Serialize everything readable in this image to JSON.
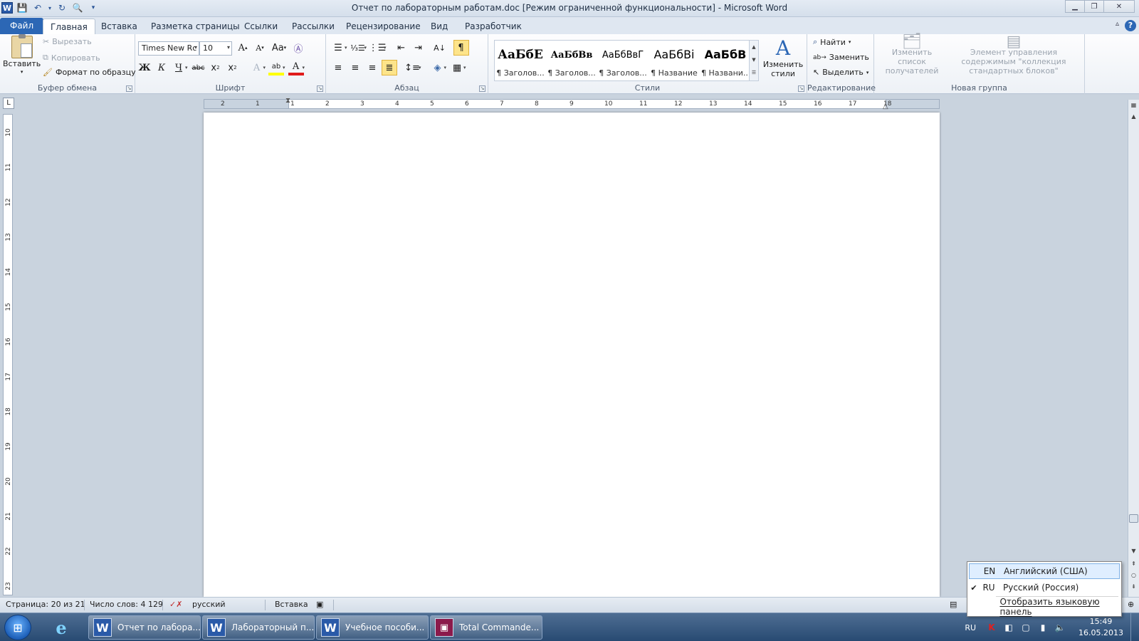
{
  "window": {
    "title": "Отчет по лабораторным работам.doc [Режим ограниченной функциональности]  -  Microsoft Word"
  },
  "tabs": [
    {
      "label": "Файл",
      "id": "file"
    },
    {
      "label": "Главная",
      "id": "home",
      "active": true
    },
    {
      "label": "Вставка",
      "id": "insert"
    },
    {
      "label": "Разметка страницы",
      "id": "layout"
    },
    {
      "label": "Ссылки",
      "id": "references"
    },
    {
      "label": "Рассылки",
      "id": "mailings"
    },
    {
      "label": "Рецензирование",
      "id": "review"
    },
    {
      "label": "Вид",
      "id": "view"
    },
    {
      "label": "Разработчик",
      "id": "developer"
    }
  ],
  "ribbon": {
    "clipboard": {
      "label": "Буфер обмена",
      "paste": "Вставить",
      "cut": "Вырезать",
      "copy": "Копировать",
      "format_painter": "Формат по образцу"
    },
    "font": {
      "label": "Шрифт",
      "font_name": "Times New Rc",
      "font_size": "10"
    },
    "paragraph": {
      "label": "Абзац"
    },
    "styles": {
      "label": "Стили",
      "change_styles": "Изменить стили",
      "items": [
        {
          "sample": "АаБбЕ",
          "name": "¶ Заголов..."
        },
        {
          "sample": "АаБбВв",
          "name": "¶ Заголов..."
        },
        {
          "sample": "АаБбВвГ",
          "name": "¶ Заголов..."
        },
        {
          "sample": "АаБбВі",
          "name": "¶ Название"
        },
        {
          "sample": "АаБбВ",
          "name": "¶ Названи..."
        }
      ]
    },
    "editing": {
      "label": "Редактирование",
      "find": "Найти",
      "replace": "Заменить",
      "select": "Выделить"
    },
    "newgroup": {
      "label": "Новая группа",
      "recipients": "Изменить список получателей",
      "building_blocks": "Элемент управления содержимым \"коллекция стандартных блоков\""
    }
  },
  "ruler": {
    "h_ticks": [
      "2",
      "1",
      "1",
      "2",
      "3",
      "4",
      "5",
      "6",
      "7",
      "8",
      "9",
      "10",
      "11",
      "12",
      "13",
      "14",
      "15",
      "16",
      "17",
      "18"
    ],
    "v_ticks": [
      "10",
      "11",
      "12",
      "13",
      "14",
      "15",
      "16",
      "17",
      "18",
      "19",
      "20",
      "21",
      "22",
      "23"
    ]
  },
  "statusbar": {
    "page": "Страница: 20 из 21",
    "words": "Число слов: 4 129",
    "language": "русский",
    "mode": "Вставка"
  },
  "taskbar": {
    "buttons": [
      {
        "label": "Отчет по лабора...",
        "icon": "word-icon"
      },
      {
        "label": "Лабораторный п...",
        "icon": "word-icon"
      },
      {
        "label": "Учебное пособи...",
        "icon": "word-icon"
      },
      {
        "label": "Total Commande...",
        "icon": "total-commander-icon"
      }
    ],
    "lang_indicator": "RU",
    "time": "15:49",
    "date": "16.05.2013"
  },
  "language_popup": {
    "items": [
      {
        "code": "EN",
        "name": "Английский (США)",
        "checked": false,
        "highlighted": true
      },
      {
        "code": "RU",
        "name": "Русский (Россия)",
        "checked": true,
        "highlighted": false
      }
    ],
    "show_bar": "Отобразить языковую панель"
  },
  "colors": {
    "file_tab": "#2c67b5",
    "ribbon_bg": "#edf1f6",
    "taskbar": "#284a72",
    "highlight_toggle": "#fde48a"
  }
}
